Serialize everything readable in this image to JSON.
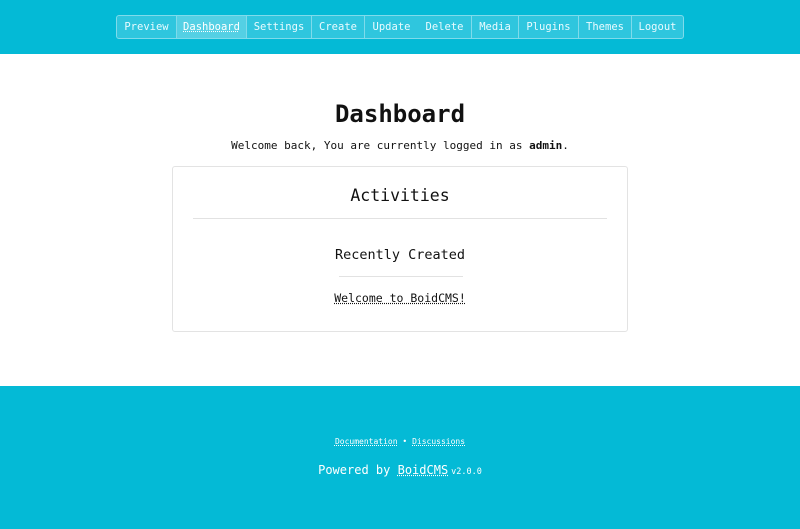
{
  "nav": {
    "items": [
      {
        "label": "Preview",
        "active": false
      },
      {
        "label": "Dashboard",
        "active": true
      },
      {
        "label": "Settings",
        "active": false
      },
      {
        "label": "Create",
        "active": false
      },
      {
        "label": "Update",
        "active": false
      },
      {
        "label": "Delete",
        "active": false
      },
      {
        "label": "Media",
        "active": false
      },
      {
        "label": "Plugins",
        "active": false
      },
      {
        "label": "Themes",
        "active": false
      },
      {
        "label": "Logout",
        "active": false
      }
    ]
  },
  "main": {
    "title": "Dashboard",
    "welcome_prefix": "Welcome back, You are currently logged in as ",
    "username": "admin",
    "welcome_suffix": ".",
    "card": {
      "title": "Activities",
      "section_title": "Recently Created",
      "recent_items": [
        "Welcome to BoidCMS!"
      ]
    }
  },
  "footer": {
    "documentation_label": "Documentation",
    "separator": "•",
    "discussions_label": "Discussions",
    "powered_prefix": "Powered by ",
    "brand": "BoidCMS",
    "version": "v2.0.0"
  },
  "colors": {
    "accent": "#04bad6",
    "nav_background": "#2fc6de",
    "nav_active": "#54d0e4"
  }
}
